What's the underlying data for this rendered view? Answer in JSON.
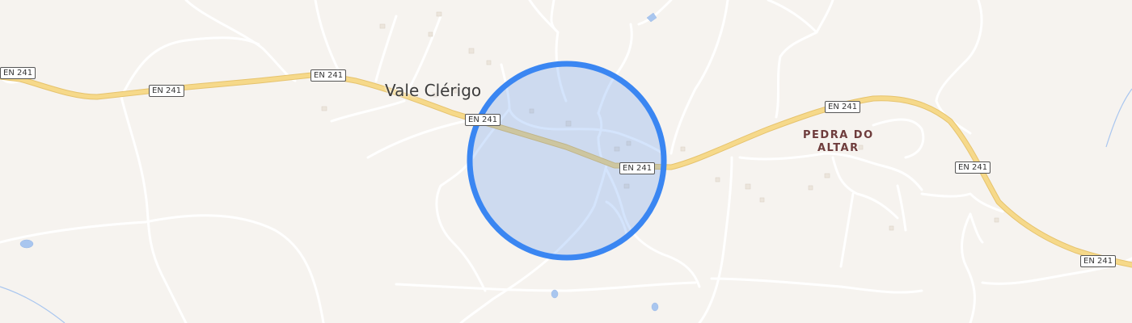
{
  "map": {
    "colors": {
      "land": "#f6f3ef",
      "minor_road": "#ffffff",
      "main_road": "#f6d98a",
      "main_road_casing": "#e6c36d",
      "water": "#a9c6ef",
      "building": "#ece5dc",
      "area_fill": "#cbdcf4",
      "area_stroke": "#3a86f2"
    },
    "places": {
      "town": "Vale Clérigo",
      "village_line1": "PEDRA DO",
      "village_line2": "ALTAR"
    },
    "road_shields": {
      "s1": "EN 241",
      "s2": "EN 241",
      "s3": "EN 241",
      "s4": "EN 241",
      "s5": "EN 241",
      "s6": "EN 241",
      "s7": "EN 241"
    },
    "highlight": {
      "shape": "circle"
    }
  }
}
